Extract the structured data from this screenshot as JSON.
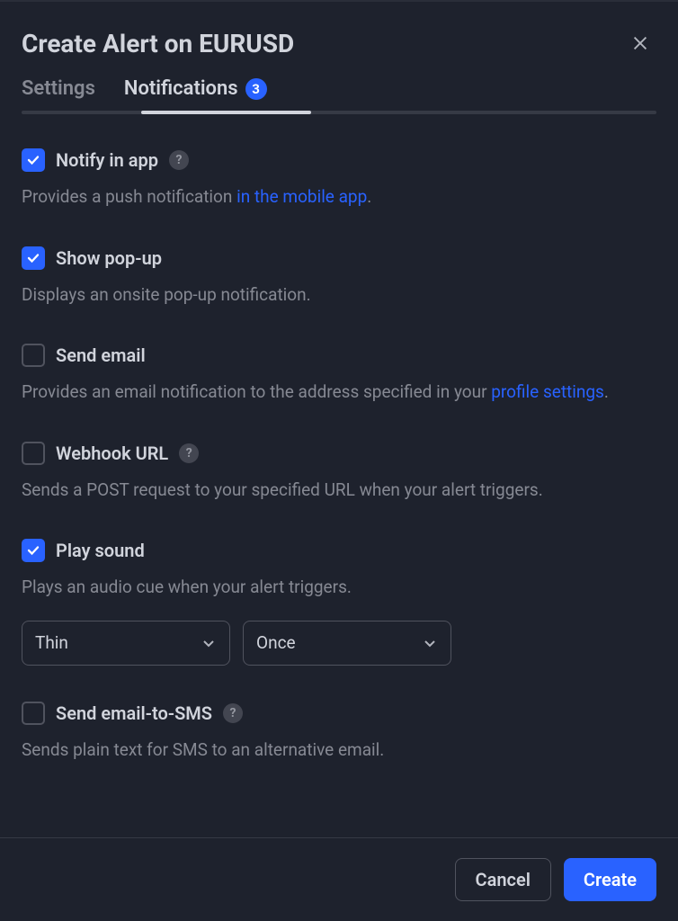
{
  "title": "Create Alert on EURUSD",
  "tabs": {
    "settings": "Settings",
    "notifications": "Notifications",
    "badge": "3"
  },
  "options": {
    "notifyApp": {
      "label": "Notify in app",
      "checked": true,
      "hasHelp": true,
      "desc_pre": "Provides a push notification ",
      "desc_link": "in the mobile app",
      "desc_post": "."
    },
    "popup": {
      "label": "Show pop-up",
      "checked": true,
      "desc": "Displays an onsite pop-up notification."
    },
    "email": {
      "label": "Send email",
      "checked": false,
      "desc_pre": "Provides an email notification to the address specified in your ",
      "desc_link": "profile settings",
      "desc_post": "."
    },
    "webhook": {
      "label": "Webhook URL",
      "checked": false,
      "hasHelp": true,
      "desc": "Sends a POST request to your specified URL when your alert triggers."
    },
    "sound": {
      "label": "Play sound",
      "checked": true,
      "desc": "Plays an audio cue when your alert triggers.",
      "soundName": "Thin",
      "soundRepeat": "Once"
    },
    "sms": {
      "label": "Send email-to-SMS",
      "checked": false,
      "hasHelp": true,
      "desc": "Sends plain text for SMS to an alternative email."
    }
  },
  "footer": {
    "cancel": "Cancel",
    "create": "Create"
  }
}
